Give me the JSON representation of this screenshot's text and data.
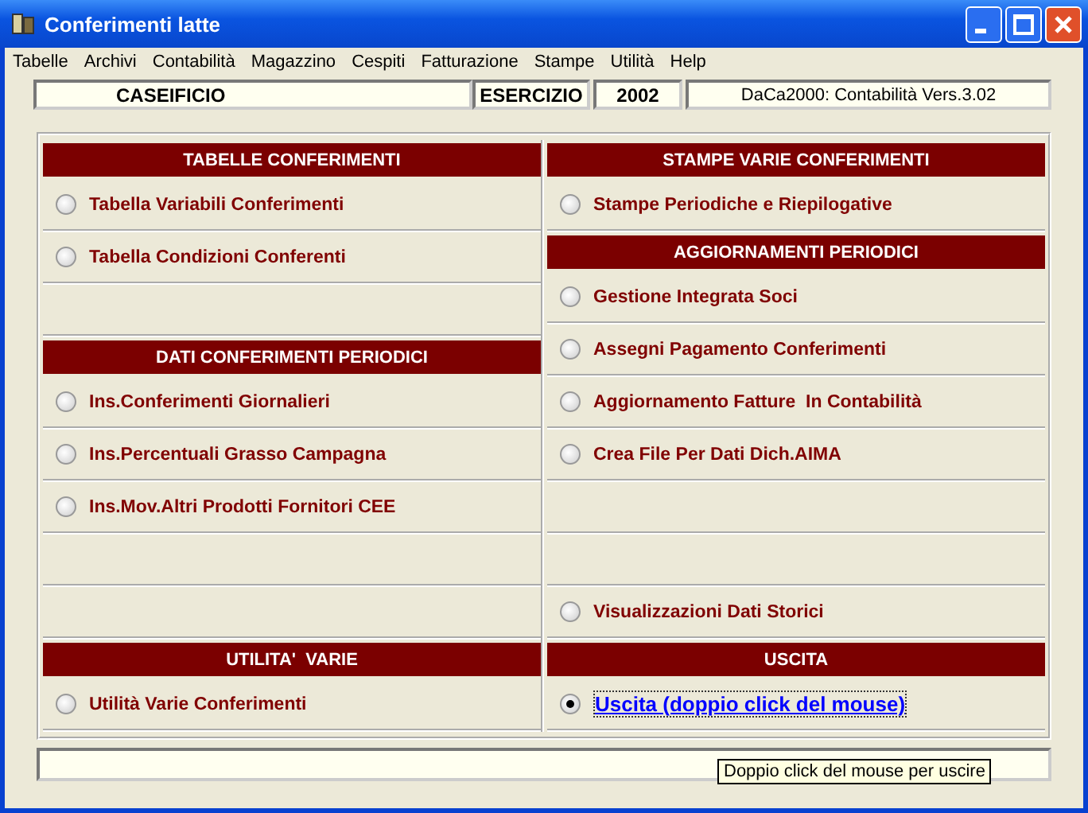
{
  "window": {
    "title": "Conferimenti latte"
  },
  "menu": [
    "Tabelle",
    "Archivi",
    "Contabilità",
    "Magazzino",
    "Cespiti",
    "Fatturazione",
    "Stampe",
    "Utilità",
    "Help"
  ],
  "info_bar": {
    "company": "CASEIFICIO",
    "year_label": "ESERCIZIO",
    "year": "2002",
    "version": "DaCa2000: Contabilità Vers.3.02"
  },
  "columns": [
    [
      {
        "kind": "header",
        "label": "TABELLE CONFERIMENTI"
      },
      {
        "kind": "option",
        "label": "Tabella Variabili Conferimenti",
        "selected": false
      },
      {
        "kind": "option",
        "label": "Tabella Condizioni Conferenti",
        "selected": false
      },
      {
        "kind": "empty"
      },
      {
        "kind": "header",
        "label": "DATI CONFERIMENTI PERIODICI"
      },
      {
        "kind": "option",
        "label": "Ins.Conferimenti Giornalieri",
        "selected": false
      },
      {
        "kind": "option",
        "label": "Ins.Percentuali Grasso Campagna",
        "selected": false
      },
      {
        "kind": "option",
        "label": "Ins.Mov.Altri Prodotti Fornitori CEE",
        "selected": false
      },
      {
        "kind": "empty"
      },
      {
        "kind": "empty"
      },
      {
        "kind": "header",
        "label": "UTILITA'  VARIE"
      },
      {
        "kind": "option",
        "label": "Utilità Varie Conferimenti",
        "selected": false
      }
    ],
    [
      {
        "kind": "header",
        "label": "STAMPE VARIE CONFERIMENTI"
      },
      {
        "kind": "option",
        "label": "Stampe Periodiche e Riepilogative",
        "selected": false
      },
      {
        "kind": "header",
        "label": "AGGIORNAMENTI PERIODICI"
      },
      {
        "kind": "option",
        "label": "Gestione Integrata Soci",
        "selected": false
      },
      {
        "kind": "option",
        "label": "Assegni Pagamento Conferimenti",
        "selected": false
      },
      {
        "kind": "option",
        "label": "Aggiornamento Fatture  In Contabilità",
        "selected": false
      },
      {
        "kind": "option",
        "label": "Crea File Per Dati Dich.AIMA",
        "selected": false
      },
      {
        "kind": "empty"
      },
      {
        "kind": "empty"
      },
      {
        "kind": "option",
        "label": "Visualizzazioni Dati Storici",
        "selected": false
      },
      {
        "kind": "header",
        "label": "USCITA"
      },
      {
        "kind": "link",
        "label": "Uscita (doppio click del mouse)",
        "selected": true
      }
    ]
  ],
  "status_bar": {
    "tooltip": "Doppio click del mouse per uscire"
  }
}
